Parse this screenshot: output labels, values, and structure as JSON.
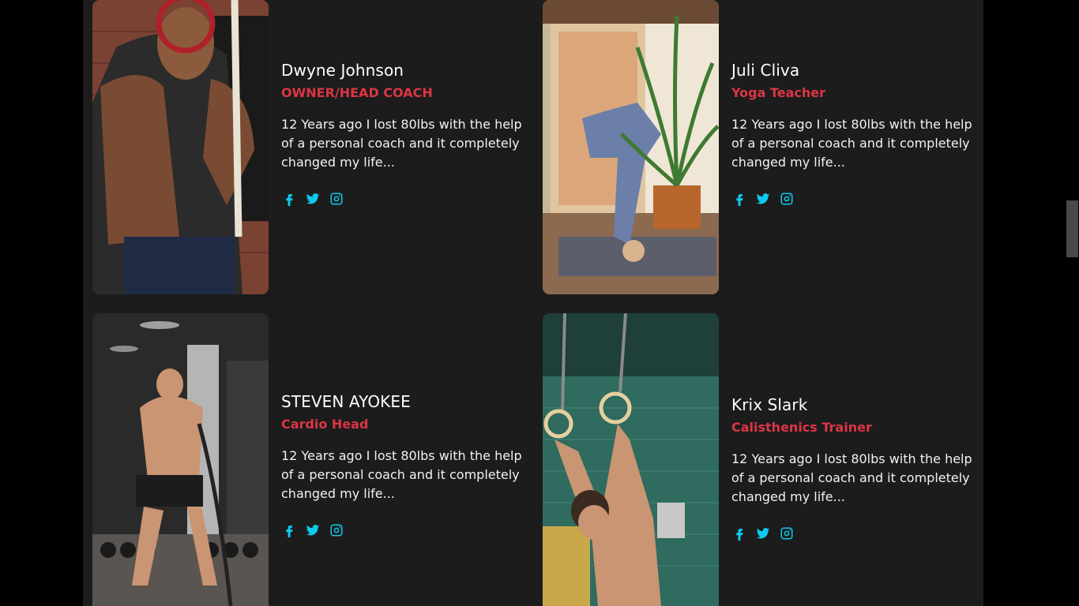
{
  "trainers": [
    {
      "name": "Dwyne Johnson",
      "role": "OWNER/HEAD COACH",
      "bio": "12 Years ago I lost 80lbs with the help of a personal coach and it completely changed my life...",
      "photo_alt": "trainer pulling gym rope"
    },
    {
      "name": "Juli Cliva",
      "role": "Yoga Teacher",
      "bio": "12 Years ago I lost 80lbs with the help of a personal coach and it completely changed my life...",
      "photo_alt": "yoga headstand near plant"
    },
    {
      "name": "STEVEN AYOKEE",
      "role": "Cardio Head",
      "bio": "12 Years ago I lost 80lbs with the help of a personal coach and it completely changed my life...",
      "photo_alt": "battle ropes workout"
    },
    {
      "name": "Krix Slark",
      "role": "Calisthenics Trainer",
      "bio": "12 Years ago I lost 80lbs with the help of a personal coach and it completely changed my life...",
      "photo_alt": "gymnastic rings workout"
    }
  ],
  "social_icons": [
    "facebook-icon",
    "twitter-icon",
    "instagram-icon"
  ],
  "colors": {
    "accent_role": "#dc3545",
    "social_icon": "#0dcaf0",
    "panel_bg": "#1c1c1c",
    "page_bg": "#000000"
  }
}
